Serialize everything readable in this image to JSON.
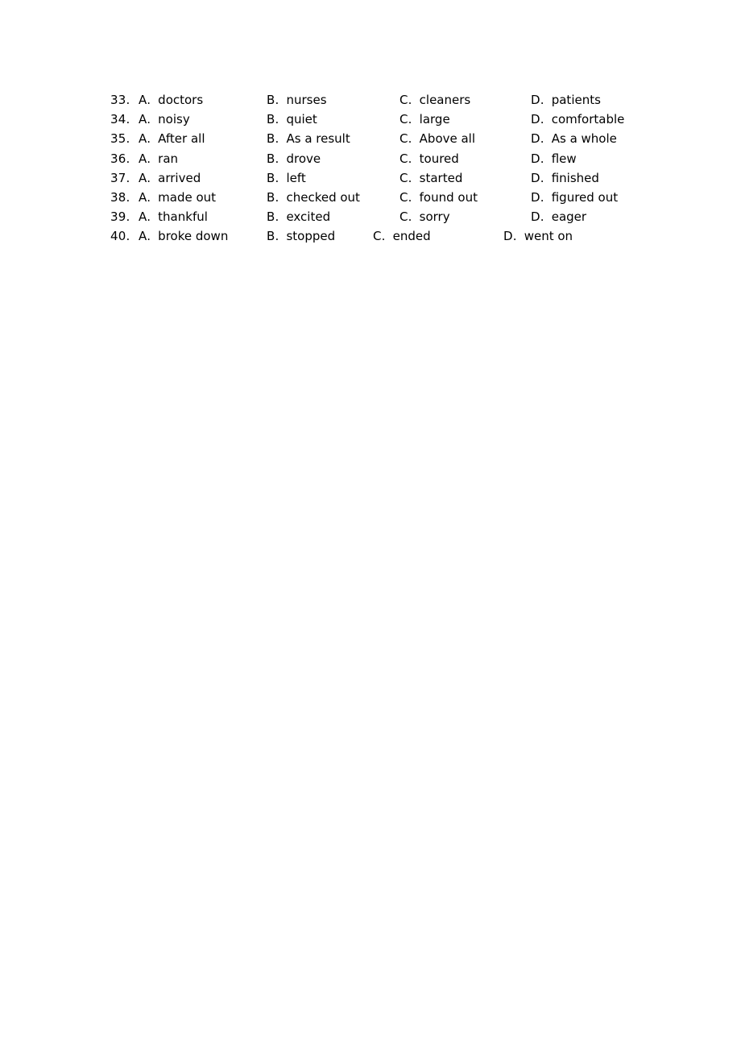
{
  "document": {
    "page_background": "#ffffff",
    "text_color": "#000000"
  },
  "questions": [
    {
      "number": "33.",
      "options": [
        {
          "letter": "A.",
          "text": "doctors"
        },
        {
          "letter": "B.",
          "text": "nurses"
        },
        {
          "letter": "C.",
          "text": "cleaners"
        },
        {
          "letter": "D.",
          "text": "patients"
        }
      ]
    },
    {
      "number": "34.",
      "options": [
        {
          "letter": "A.",
          "text": "noisy"
        },
        {
          "letter": "B.",
          "text": "quiet"
        },
        {
          "letter": "C.",
          "text": "large"
        },
        {
          "letter": "D.",
          "text": "comfortable"
        }
      ]
    },
    {
      "number": "35.",
      "options": [
        {
          "letter": "A.",
          "text": "After all"
        },
        {
          "letter": "B.",
          "text": "As a result"
        },
        {
          "letter": "C.",
          "text": "Above all"
        },
        {
          "letter": "D.",
          "text": "As a whole"
        }
      ]
    },
    {
      "number": "36.",
      "options": [
        {
          "letter": "A.",
          "text": "ran"
        },
        {
          "letter": "B.",
          "text": "drove"
        },
        {
          "letter": "C.",
          "text": "toured"
        },
        {
          "letter": "D.",
          "text": "flew"
        }
      ]
    },
    {
      "number": "37.",
      "options": [
        {
          "letter": "A.",
          "text": "arrived"
        },
        {
          "letter": "B.",
          "text": "left"
        },
        {
          "letter": "C.",
          "text": "started"
        },
        {
          "letter": "D.",
          "text": "finished"
        }
      ]
    },
    {
      "number": "38.",
      "options": [
        {
          "letter": "A.",
          "text": "made out"
        },
        {
          "letter": "B.",
          "text": "checked out"
        },
        {
          "letter": "C.",
          "text": "found out"
        },
        {
          "letter": "D.",
          "text": "figured out"
        }
      ]
    },
    {
      "number": "39.",
      "options": [
        {
          "letter": "A.",
          "text": "thankful"
        },
        {
          "letter": "B.",
          "text": "excited"
        },
        {
          "letter": "C.",
          "text": "sorry"
        },
        {
          "letter": "D.",
          "text": "eager"
        }
      ]
    },
    {
      "number": "40.",
      "options": [
        {
          "letter": "A.",
          "text": "broke down"
        },
        {
          "letter": "B.",
          "text": "stopped"
        },
        {
          "letter": "C.",
          "text": "ended"
        },
        {
          "letter": "D.",
          "text": "went on"
        }
      ]
    }
  ]
}
